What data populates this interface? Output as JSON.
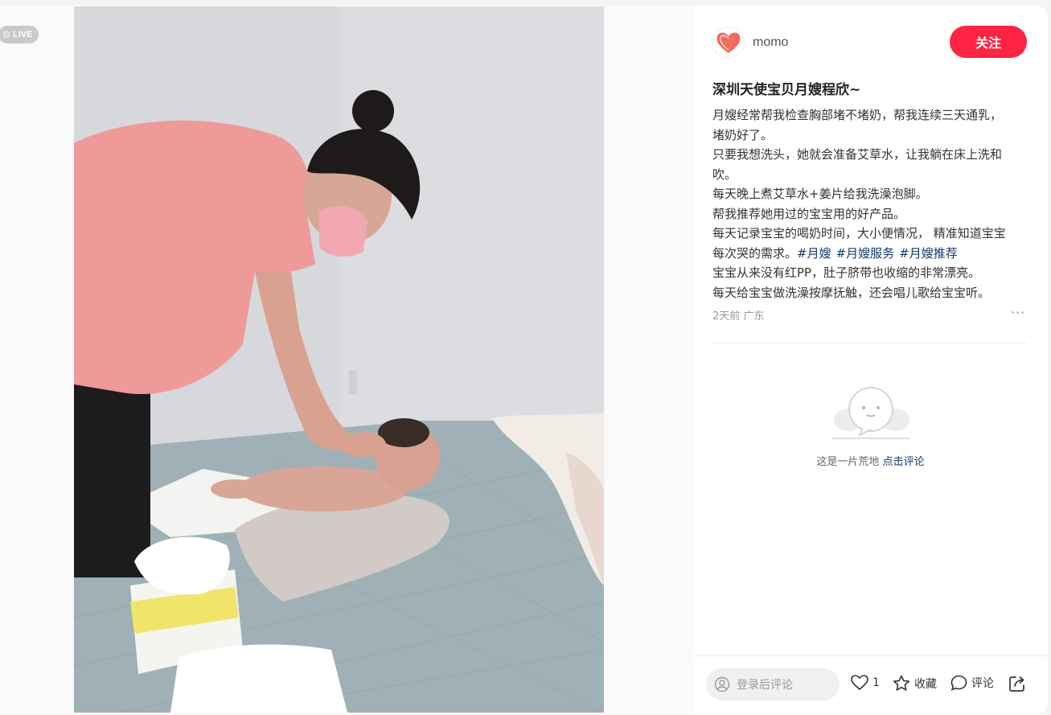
{
  "live_badge": "LIVE",
  "author": {
    "name": "momo",
    "follow_label": "关注"
  },
  "note": {
    "title": "深圳天使宝贝月嫂程欣~",
    "lines": [
      "月嫂经常帮我检查胸部堵不堵奶，帮我连续三天通乳，",
      "堵奶好了。",
      "只要我想洗头，她就会准备艾草水，让我躺在床上洗和",
      "吹。",
      "每天晚上煮艾草水+姜片给我洗澡泡脚。",
      "帮我推荐她用过的宝宝用的好产品。",
      "每天记录宝宝的喝奶时间，大小便情况， 精准知道宝宝",
      "每次哭的需求。"
    ],
    "tags": [
      "#月嫂",
      "#月嫂服务",
      "#月嫂推荐"
    ],
    "lines_after": [
      "宝宝从来没有红PP，肚子脐带也收缩的非常漂亮。",
      "每天给宝宝做洗澡按摩抚触，还会唱儿歌给宝宝听。"
    ],
    "date": "2天前",
    "location": "广东",
    "more": "···"
  },
  "comments": {
    "empty_text": "这是一片荒地",
    "empty_link": "点击评论"
  },
  "bottom": {
    "input_placeholder": "登录后评论",
    "like_count": "1",
    "collect_label": "收藏",
    "comment_label": "评论"
  },
  "colors": {
    "accent": "#ff2442",
    "tag": "#13386c"
  },
  "icons": [
    "live-icon",
    "heart-avatar-icon",
    "more-icon",
    "empty-chat-icon",
    "user-icon",
    "heart-icon",
    "star-icon",
    "comment-icon",
    "share-icon"
  ]
}
